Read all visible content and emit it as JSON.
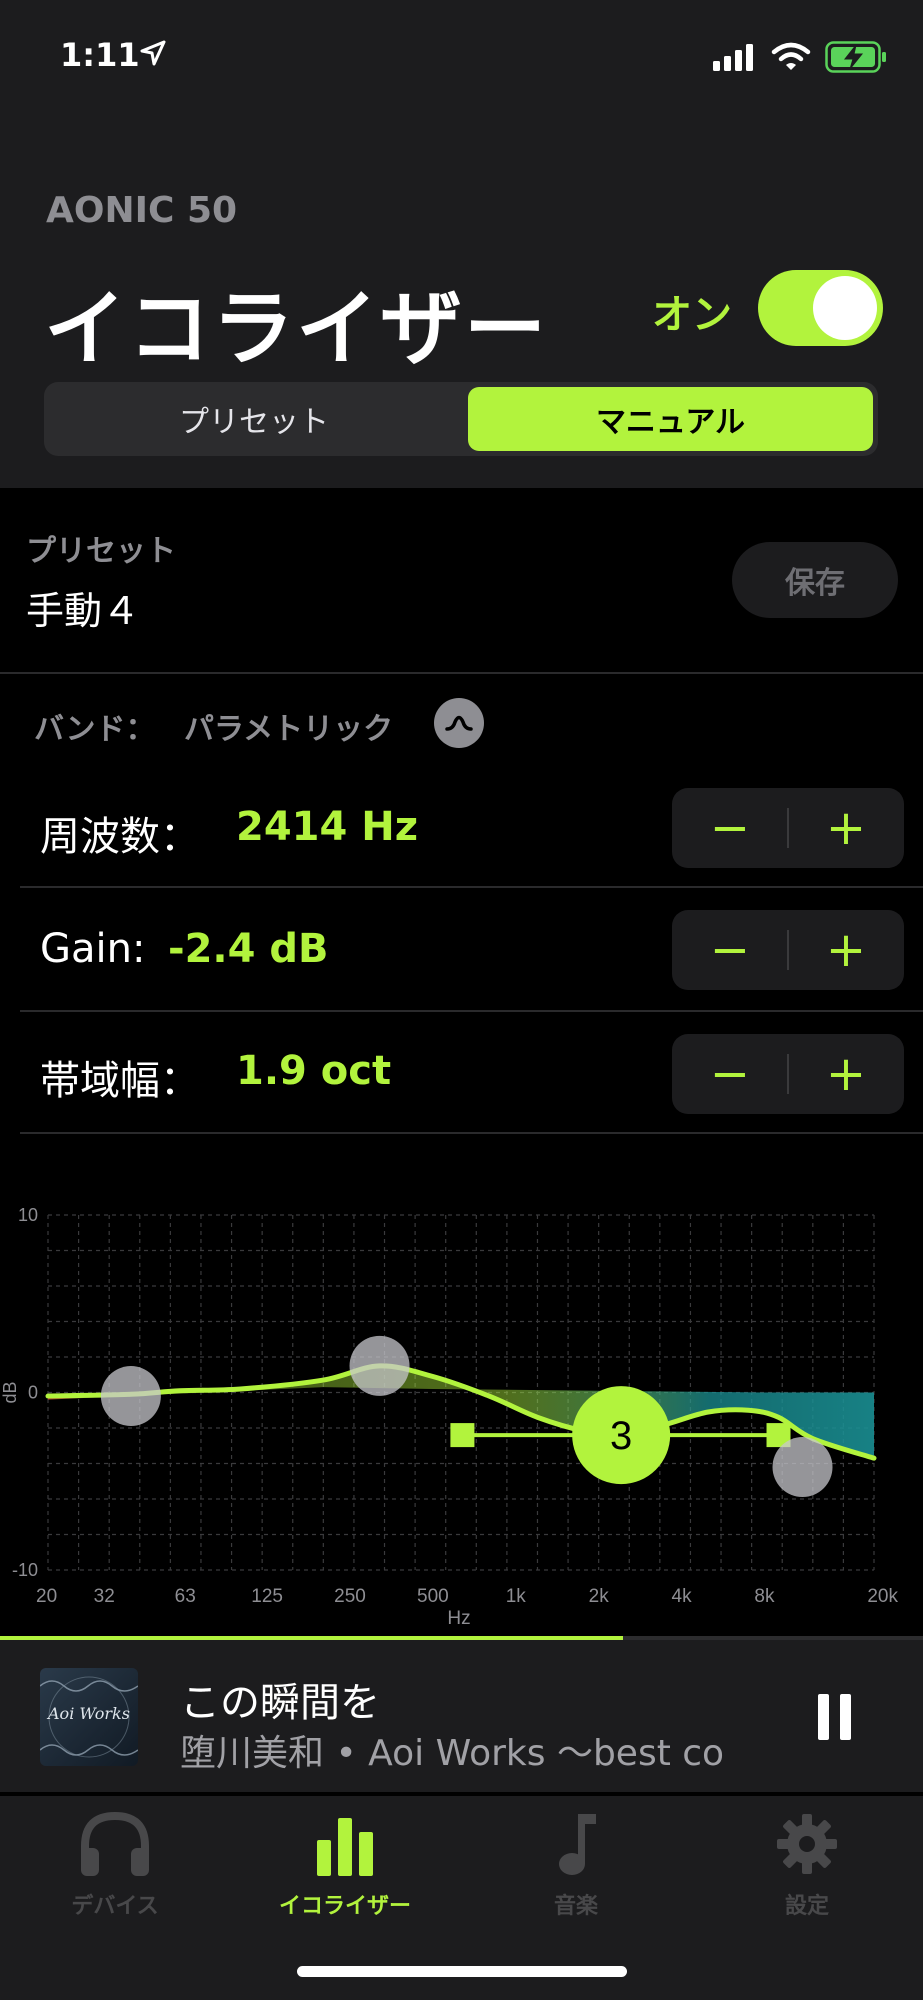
{
  "status_bar": {
    "time": "1:11",
    "icons": [
      "location-arrow-icon",
      "cellular-signal-icon",
      "wifi-icon",
      "battery-charging-icon"
    ]
  },
  "header": {
    "device_name": "AONIC 50",
    "title": "イコライザー",
    "toggle_label": "オン",
    "toggle_on": true,
    "segments": [
      "プリセット",
      "マニュアル"
    ],
    "selected_segment": "マニュアル"
  },
  "preset": {
    "label": "プリセット",
    "value": "手動４",
    "save_label": "保存"
  },
  "band": {
    "label": "バンド：",
    "value": "パラメトリック"
  },
  "params": [
    {
      "label": "周波数：",
      "value": "2414 Hz"
    },
    {
      "label": "Gain:",
      "value": "-2.4 dB"
    },
    {
      "label": "帯域幅：",
      "value": "1.9 oct"
    }
  ],
  "stepper": {
    "minus": "−",
    "plus": "+"
  },
  "chart_data": {
    "type": "line",
    "xlabel": "Hz",
    "ylabel": "dB",
    "x_scale": "log",
    "x_ticks": [
      "20",
      "32",
      "63",
      "125",
      "250",
      "500",
      "1k",
      "2k",
      "4k",
      "8k",
      "20k"
    ],
    "y_ticks": [
      "10",
      "0",
      "-10"
    ],
    "ylim": [
      -10,
      10
    ],
    "grid": true,
    "bands": [
      {
        "freq": 40,
        "gain": -0.2,
        "label": "",
        "selected": false
      },
      {
        "freq": 320,
        "gain": 1.5,
        "label": "",
        "selected": false
      },
      {
        "freq": 2414,
        "gain": -2.4,
        "label": "3",
        "selected": true
      },
      {
        "freq": 11000,
        "gain": -4.2,
        "label": "",
        "selected": false
      }
    ],
    "selected_bandwidth_handles_hz": [
      640,
      9000
    ],
    "curve": {
      "freq": [
        20,
        40,
        60,
        100,
        200,
        320,
        500,
        800,
        1200,
        1800,
        2414,
        3500,
        5000,
        7000,
        9000,
        12000,
        20000
      ],
      "gain": [
        -0.2,
        -0.1,
        0.1,
        0.2,
        0.7,
        1.5,
        0.9,
        -0.2,
        -1.4,
        -2.2,
        -2.4,
        -1.8,
        -1.1,
        -1.0,
        -1.4,
        -2.6,
        -3.7
      ]
    },
    "colors": {
      "accent": "#b2f33d",
      "fill_teal": "#1a8f93",
      "fill_red": "#c23a2e",
      "node_gray": "#c7c7cc"
    }
  },
  "now_playing": {
    "title": "この瞬間を",
    "subtitle": "堕川美和 • Aoi Works 〜best colle",
    "album_text": "Aoi Works",
    "progress": 0.675,
    "pause_icon": "pause-icon"
  },
  "tabs": [
    {
      "label": "デバイス",
      "icon": "headphones-icon",
      "active": false
    },
    {
      "label": "イコライザー",
      "icon": "equalizer-bars-icon",
      "active": true
    },
    {
      "label": "音楽",
      "icon": "music-note-icon",
      "active": false
    },
    {
      "label": "設定",
      "icon": "gear-icon",
      "active": false
    }
  ]
}
